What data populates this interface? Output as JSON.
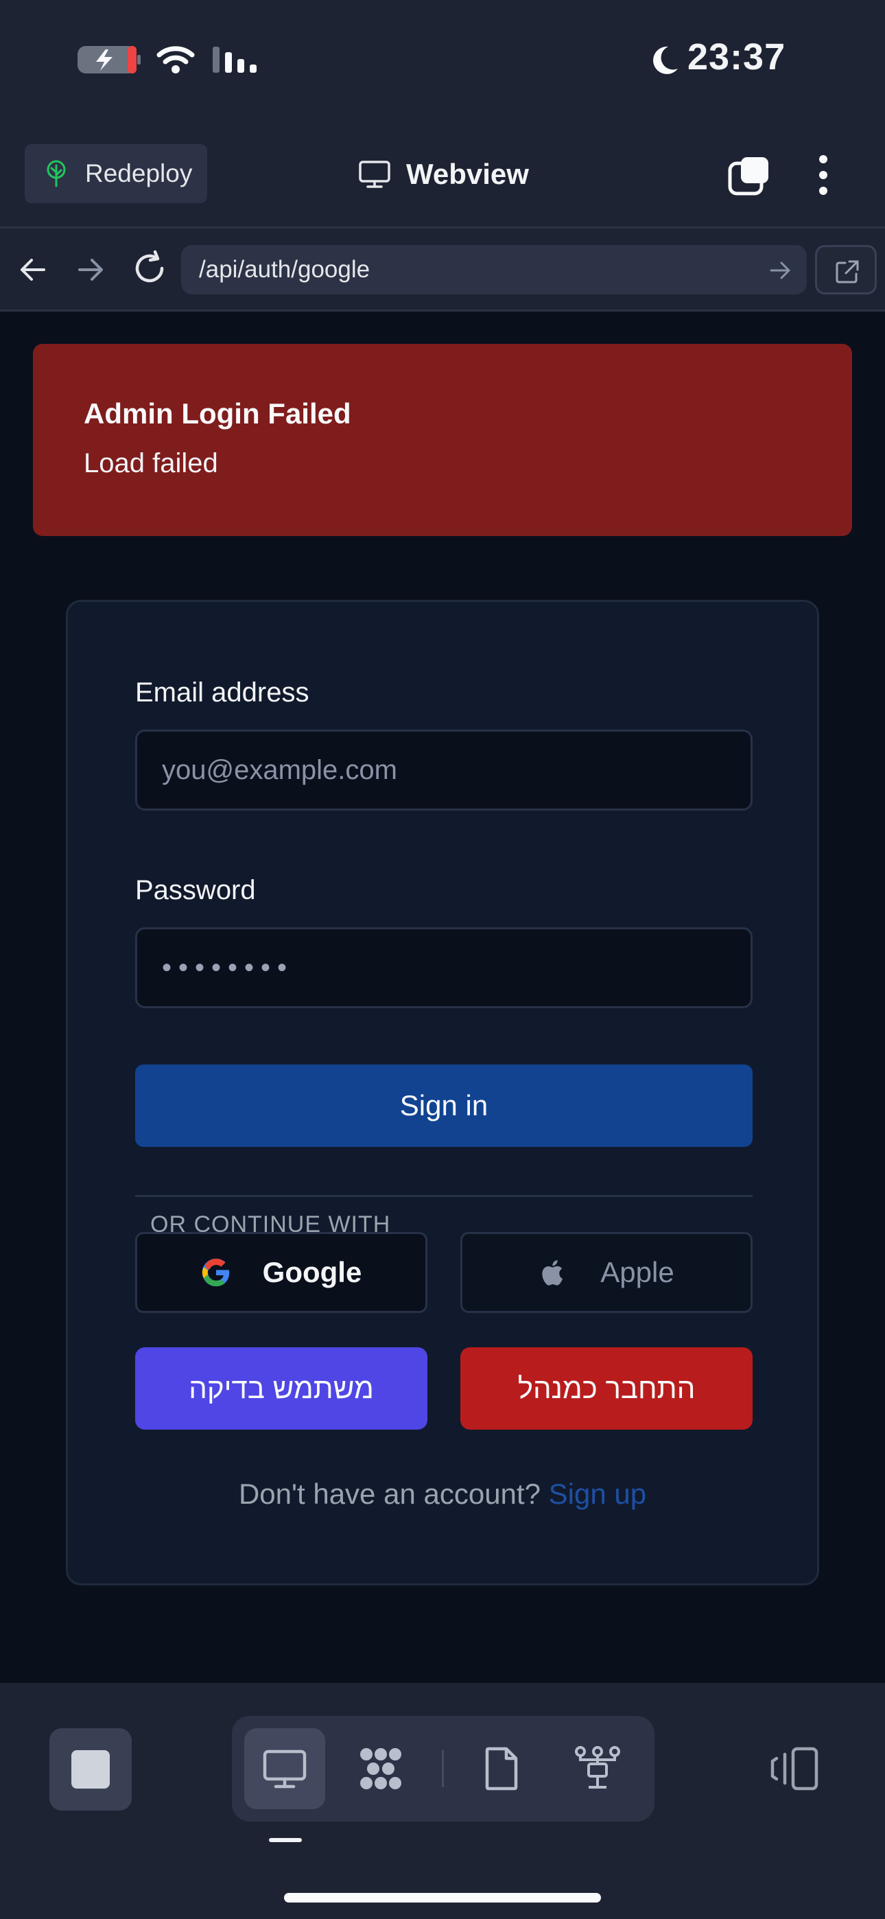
{
  "status_bar": {
    "time": "23:37",
    "battery_level": 0.2,
    "battery_charging": true,
    "icons": [
      "battery-charging-icon",
      "wifi-icon",
      "signal-icon",
      "moon-icon"
    ]
  },
  "toolbar": {
    "redeploy_label": "Redeploy",
    "title": "Webview",
    "icons": [
      "redeploy-tree-icon",
      "monitor-icon",
      "tabs-icon",
      "more-vertical-icon"
    ]
  },
  "url_bar": {
    "url": "/api/auth/google",
    "icons": [
      "arrow-left-icon",
      "arrow-right-icon",
      "reload-icon",
      "go-arrow-icon",
      "external-link-icon"
    ]
  },
  "alert": {
    "title": "Admin Login Failed",
    "message": "Load failed",
    "color": "#7f1d1d"
  },
  "login_form": {
    "email_label": "Email address",
    "email_placeholder": "you@example.com",
    "password_label": "Password",
    "password_value": "••••••••",
    "signin_label": "Sign in",
    "divider_text": "OR CONTINUE WITH",
    "google_label": "Google",
    "apple_label": "Apple",
    "test_user_label": "משתמש בדיקה",
    "admin_login_label": "התחבר כמנהל",
    "signup_prompt": "Don't have an account?",
    "signup_link": "Sign up",
    "colors": {
      "primary": "#114391",
      "test_user": "#4f46e5",
      "admin": "#b91c1c",
      "link": "#1e4fa3"
    }
  },
  "bottom_bar": {
    "icons": [
      "stop-icon",
      "monitor-icon",
      "dots-grid-icon",
      "file-icon",
      "network-icon",
      "device-rotate-icon"
    ],
    "active_tool": "monitor"
  }
}
